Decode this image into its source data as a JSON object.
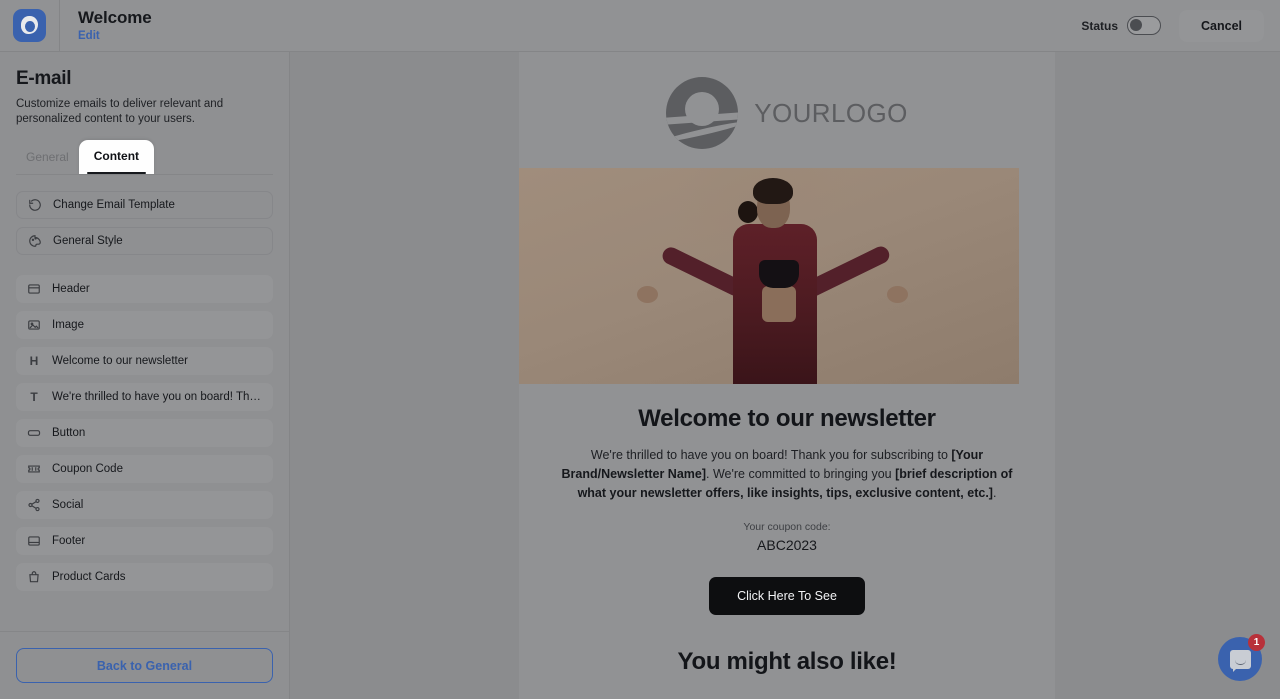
{
  "topbar": {
    "logo_icon": "app-logo-icon",
    "title": "Welcome",
    "edit_link": "Edit",
    "status_label": "Status",
    "status_on": false,
    "cancel_label": "Cancel",
    "accent_blue": "#3a62ae"
  },
  "sidebar": {
    "title": "E-mail",
    "subtitle": "Customize emails to deliver relevant and personalized content to your users.",
    "tabs": [
      {
        "label": "General",
        "active": false
      },
      {
        "label": "Content",
        "active": true
      }
    ],
    "groups": [
      {
        "style": "outlined",
        "items": [
          {
            "label": "Change Email Template",
            "icon": "refresh-icon"
          },
          {
            "label": "General Style",
            "icon": "palette-icon"
          }
        ]
      },
      {
        "style": "filled",
        "items": [
          {
            "label": "Header",
            "icon": "header-block-icon"
          },
          {
            "label": "Image",
            "icon": "image-block-icon"
          },
          {
            "label": "Welcome to our newsletter",
            "icon": "heading-h-icon"
          },
          {
            "label": "We're thrilled to have you on board! Tha...",
            "icon": "text-t-icon"
          },
          {
            "label": "Button",
            "icon": "button-block-icon"
          },
          {
            "label": "Coupon Code",
            "icon": "ticket-icon"
          },
          {
            "label": "Social",
            "icon": "share-icon"
          },
          {
            "label": "Footer",
            "icon": "footer-block-icon"
          },
          {
            "label": "Product Cards",
            "icon": "shopping-bag-icon"
          }
        ]
      }
    ],
    "back_button": "Back to General"
  },
  "preview": {
    "brand": {
      "logo_icon": "yourlogo-circle-icon",
      "text": "YOURLOGO"
    },
    "hero_image_alt": "fashion-model-photo",
    "heading": "Welcome to our newsletter",
    "paragraph": {
      "part1": "We're thrilled to have you on board! Thank you for subscribing to ",
      "bold1": "[Your Brand/Newsletter Name]",
      "part2": ". We're committed to bringing you ",
      "bold2": "[brief description of what your newsletter offers, like insights, tips, exclusive content, etc.]",
      "part3": "."
    },
    "coupon_label": "Your coupon code:",
    "coupon_code": "ABC2023",
    "cta_label": "Click Here To See",
    "section_heading": "You might also like!"
  },
  "chat": {
    "icon": "chat-bubble-icon",
    "badge_count": "1",
    "badge_color": "#b8313a"
  }
}
